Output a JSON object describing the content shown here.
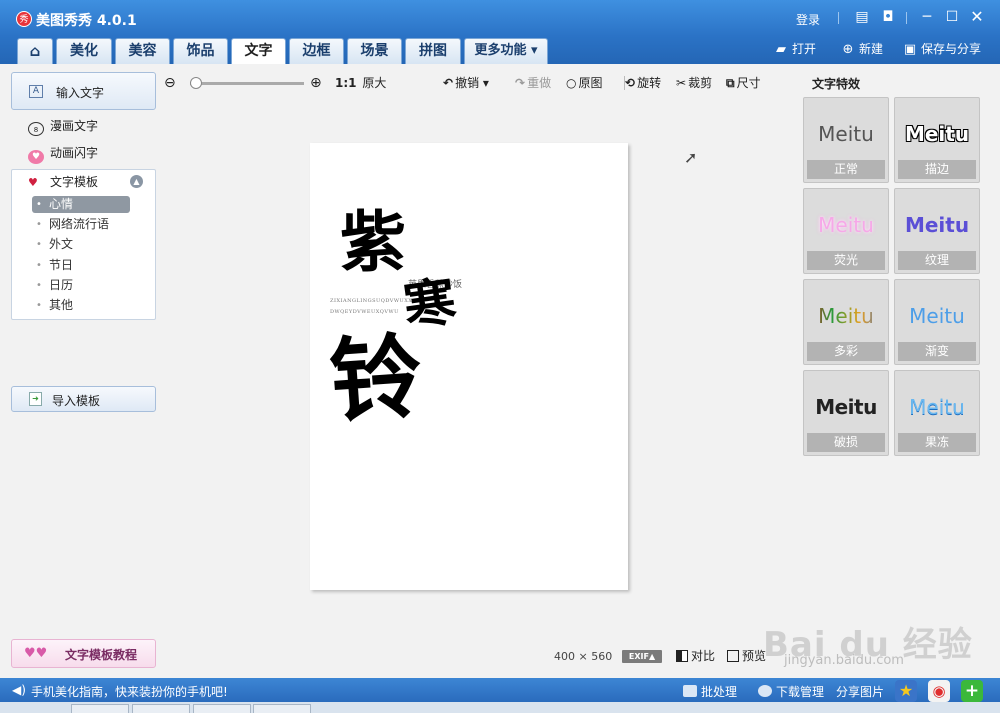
{
  "window": {
    "app_title": "美图秀秀 4.0.1",
    "logo_glyph": "秀",
    "login": "登录"
  },
  "tabs": {
    "home_glyph": "⌂",
    "items": [
      "美化",
      "美容",
      "饰品",
      "文字",
      "边框",
      "场景",
      "拼图"
    ],
    "active": "文字",
    "more": "更多功能 ▾"
  },
  "top_actions": {
    "open": "打开",
    "new": "新建",
    "save_share": "保存与分享"
  },
  "sidebar": {
    "input_text": "输入文字",
    "comic_text": "漫画文字",
    "animated_text": "动画闪字",
    "template_header": "文字模板",
    "categories": [
      "心情",
      "网络流行语",
      "外文",
      "节日",
      "日历",
      "其他"
    ],
    "selected_category": "心情",
    "import_template": "导入模板",
    "tutorial": "文字模板教程"
  },
  "toolbar": {
    "zoom_ratio": "1:1",
    "original_size": "原大",
    "undo": "撤销",
    "redo": "重做",
    "original": "原图",
    "rotate": "旋转",
    "crop": "裁剪",
    "size": "尺寸"
  },
  "canvas": {
    "char_1": "紫",
    "char_2": "寒",
    "char_3": "铃",
    "small_cn": "苹果香蕉炒饭",
    "small_en_1": "ZIXIANGLINGSUQDVWUXX",
    "small_en_2": "DWQEYDVWEUXQVWU"
  },
  "effects": {
    "title": "文字特效",
    "sample_text": "Meitu",
    "items": [
      {
        "name": "正常",
        "color": "#555555"
      },
      {
        "name": "描边",
        "color": "#ffffff"
      },
      {
        "name": "荧光",
        "color": "#f6a8e8"
      },
      {
        "name": "纹理",
        "color": "#5b4fd6"
      },
      {
        "name": "多彩",
        "color": "#e02020"
      },
      {
        "name": "渐变",
        "color": "#4d9ee8"
      },
      {
        "name": "破损",
        "color": "#222222"
      },
      {
        "name": "果冻",
        "color": "#6ab8f0"
      }
    ]
  },
  "bottom": {
    "width": "400",
    "times": "×",
    "height": "560",
    "exif": "EXIF▲",
    "compare": "对比",
    "preview": "预览"
  },
  "statusbar": {
    "message": "手机美化指南，快来装扮你的手机吧!",
    "batch": "批处理",
    "download_manager": "下载管理",
    "share_image": "分享图片"
  },
  "watermark": {
    "main": "Bai du 经验",
    "sub": "jingyan.baidu.com"
  }
}
